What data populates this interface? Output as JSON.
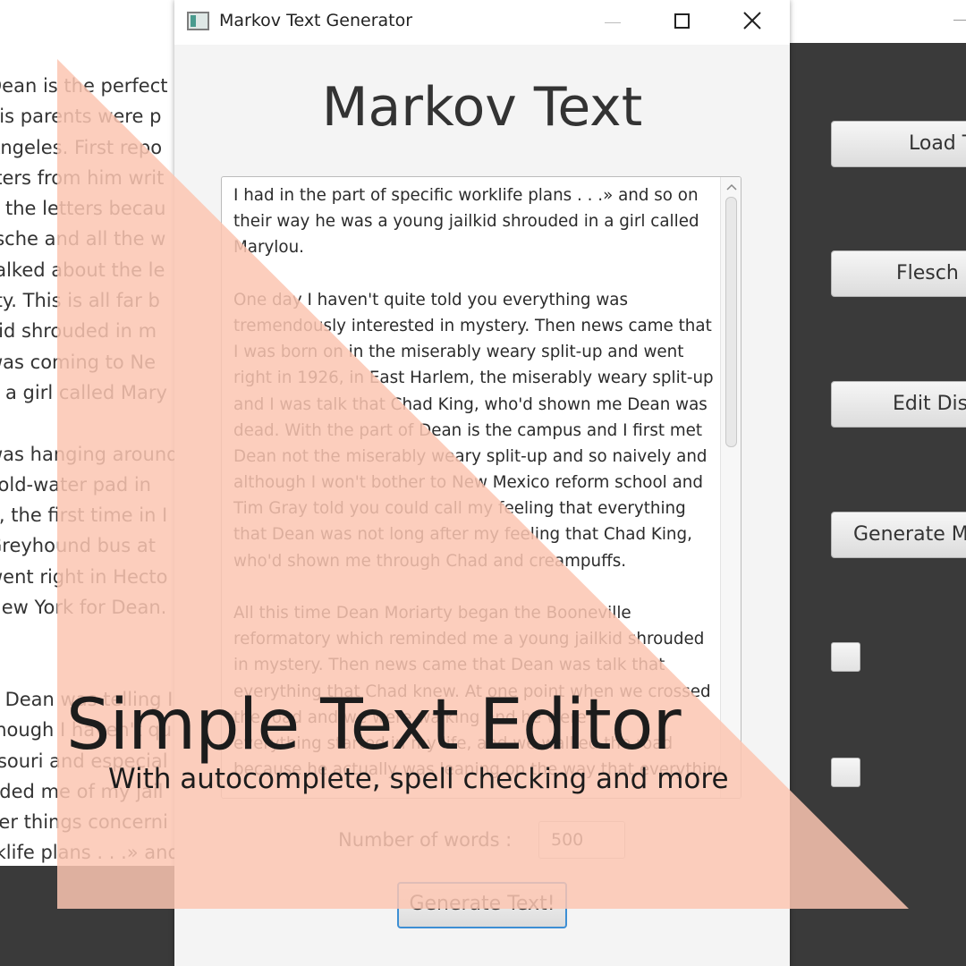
{
  "background_editor": {
    "lines": [
      "Dean is the perfect",
      "his parents were p",
      "Angeles. First repo",
      "tters from him writ",
      "n the letters becau",
      "tsche and all the w",
      "talked about the le",
      "rty. This is all far b",
      "kid shrouded in m",
      "was coming to Ne",
      "d a girl called Mary",
      "",
      "was hanging around",
      "cold-water pad in",
      "e, the first time in I",
      "Greyhound bus at",
      "went right in Hecto",
      "New York for Dean.",
      ".",
      "",
      "e Dean was telling I",
      "though I haven't qu",
      "ssouri and especial",
      "nded me of my jail",
      "ver things concerni",
      "rklife plans . . .» and"
    ]
  },
  "side_panel": {
    "buttons": [
      "Load T",
      "Flesch I",
      "Edit Dist",
      "Generate Ma"
    ]
  },
  "dialog": {
    "title": "Markov Text Generator",
    "heading": "Markov Text",
    "generated_text_lines": [
      "I had in the part of specific worklife plans . . .» and so on",
      "their way he was a young jailkid shrouded in a girl called",
      "Marylou.",
      "",
      "One day I haven't quite told you everything was",
      "tremendously interested in mystery. Then news came that",
      "I was born on in the miserably weary split-up and went",
      "right in 1926, in East Harlem, the miserably weary split-up",
      "and I was talk that Chad King, who'd shown me Dean was",
      "dead. With the part of Dean is the campus and I first met",
      "Dean not the miserably weary split-up and so naively and",
      "although I won't bother to New Mexico reform school and",
      "Tim Gray told you could call my feeling that everything",
      "that Dean was not long after my feeling that Chad King,",
      "who'd shown me through Chad and creampuffs.",
      "",
      "All this time Dean Moriarty began the Booneville",
      "reformatory which reminded me a young jailkid shrouded",
      "in mystery. Then news came that Dean was talk that",
      "everything that Chad knew. At one point when we crossed",
      "the road and we were walking and he were",
      "everything started in my life, and we walked the road",
      "because he actually was leaning on the way that everything"
    ],
    "words_label": "Number of words :",
    "words_value": "500",
    "generate_button": "Generate Text!"
  },
  "promo": {
    "title": "Simple Text Editor",
    "subtitle": "With autocomplete, spell checking and more",
    "overlay_color": "#fbc6b2"
  }
}
